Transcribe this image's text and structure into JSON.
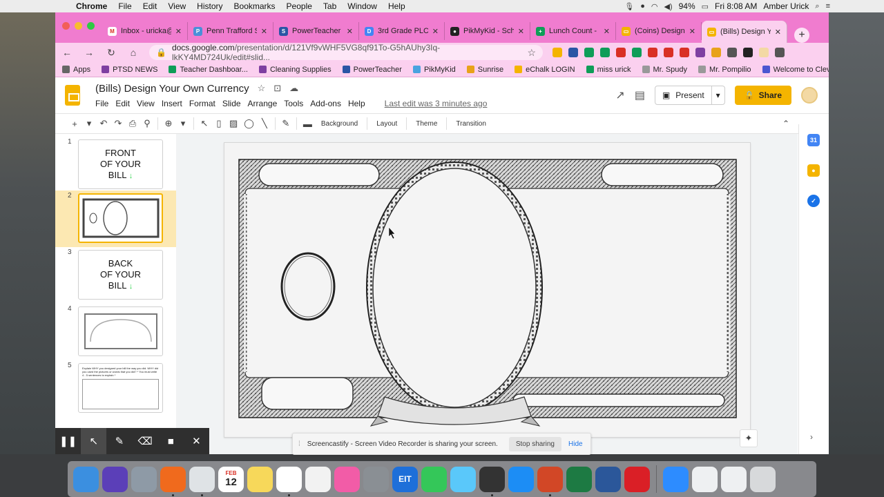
{
  "macos": {
    "app_name": "Chrome",
    "menu": [
      "File",
      "Edit",
      "View",
      "History",
      "Bookmarks",
      "People",
      "Tab",
      "Window",
      "Help"
    ],
    "battery": "94%",
    "clock": "Fri 8:08 AM",
    "user": "Amber Urick"
  },
  "browser": {
    "tabs": [
      {
        "label": "Inbox - uricka@",
        "color": "#ffffff",
        "glyph": "M"
      },
      {
        "label": "Penn Trafford S",
        "color": "#4a90d9",
        "glyph": "P"
      },
      {
        "label": "PowerTeacher",
        "color": "#2a55a5",
        "glyph": "S"
      },
      {
        "label": "3rd Grade PLC",
        "color": "#4285f4",
        "glyph": "D"
      },
      {
        "label": "PikMyKid - Sch",
        "color": "#222222",
        "glyph": "●"
      },
      {
        "label": "Lunch Count -",
        "color": "#0f9d58",
        "glyph": "+"
      },
      {
        "label": "(Coins) Design",
        "color": "#f4b400",
        "glyph": "▭"
      },
      {
        "label": "(Bills) Design Y",
        "color": "#f4b400",
        "glyph": "▭"
      }
    ],
    "url_host": "docs.google.com",
    "url_path": "/presentation/d/121Vf9vWHF5VG8qf91To-G5hAUhy3Iq-lkKY4MD724Uk/edit#slid...",
    "bookmarks": [
      {
        "label": "Apps",
        "color": "#666666"
      },
      {
        "label": "PTSD NEWS",
        "color": "#7e3fa1"
      },
      {
        "label": "Teacher Dashboar...",
        "color": "#0f9d58"
      },
      {
        "label": "Cleaning Supplies",
        "color": "#7e3fa1"
      },
      {
        "label": "PowerTeacher",
        "color": "#2a55a5"
      },
      {
        "label": "PikMyKid",
        "color": "#4aa3df"
      },
      {
        "label": "Sunrise",
        "color": "#e8a21a"
      },
      {
        "label": "eChalk LOGIN",
        "color": "#f4b400"
      },
      {
        "label": "miss urick",
        "color": "#0f9d58"
      },
      {
        "label": "Mr. Spudy",
        "color": "#999999"
      },
      {
        "label": "Mr. Pompilio",
        "color": "#999999"
      },
      {
        "label": "Welcome to Cleve...",
        "color": "#4b57d1"
      }
    ],
    "bookmarks_more": "»"
  },
  "slides": {
    "title": "(Bills) Design Your Own Currency",
    "menu": [
      "File",
      "Edit",
      "View",
      "Insert",
      "Format",
      "Slide",
      "Arrange",
      "Tools",
      "Add-ons",
      "Help"
    ],
    "last_edit": "Last edit was 3 minutes ago",
    "present_label": "Present",
    "share_label": "Share",
    "toolbar_words": [
      "Background",
      "Layout",
      "Theme",
      "Transition"
    ],
    "thumbnails": [
      {
        "num": "1",
        "lines": [
          "FRONT",
          "OF YOUR",
          "BILL"
        ]
      },
      {
        "num": "2"
      },
      {
        "num": "3",
        "lines": [
          "BACK",
          "OF YOUR",
          "BILL"
        ]
      },
      {
        "num": "4"
      },
      {
        "num": "5",
        "caption": "Explain WHY you designed your bill the way you did. WHY did you used the pictures or words that you did? * You must write 4 - 5 sentences to explain *"
      }
    ]
  },
  "screencastify": {
    "message": "Screencastify - Screen Video Recorder is sharing your screen.",
    "stop_label": "Stop sharing",
    "hide_label": "Hide"
  },
  "dock": {
    "calendar_month": "FEB",
    "calendar_day": "12",
    "apps": [
      {
        "name": "finder",
        "color": "#3b8fe0"
      },
      {
        "name": "siri",
        "color": "#5b3fb8"
      },
      {
        "name": "launchpad",
        "color": "#8e9aa6"
      },
      {
        "name": "firefox",
        "color": "#f06a1d"
      },
      {
        "name": "chrome",
        "color": "#dfe3e6"
      },
      {
        "name": "calendar",
        "color": "#ffffff"
      },
      {
        "name": "notes",
        "color": "#f7d85a"
      },
      {
        "name": "reminders",
        "color": "#ffffff"
      },
      {
        "name": "photos",
        "color": "#f2f2f2"
      },
      {
        "name": "itunes",
        "color": "#f25ca7"
      },
      {
        "name": "system-preferences",
        "color": "#8a8f94"
      },
      {
        "name": "eit",
        "color": "#1e6fd9"
      },
      {
        "name": "facetime",
        "color": "#34c759"
      },
      {
        "name": "messages",
        "color": "#5ac8fa"
      },
      {
        "name": "acrobat",
        "color": "#333333"
      },
      {
        "name": "app-store",
        "color": "#1c8df5"
      },
      {
        "name": "powerpoint",
        "color": "#d24726"
      },
      {
        "name": "excel",
        "color": "#1d7a43"
      },
      {
        "name": "word",
        "color": "#2b579a"
      },
      {
        "name": "creative-cloud",
        "color": "#da1f26"
      },
      {
        "name": "zoom",
        "color": "#2d8cff"
      }
    ],
    "eit_label": "EIT"
  }
}
